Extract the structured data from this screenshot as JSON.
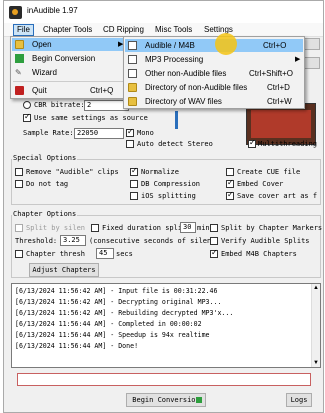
{
  "app": {
    "title": "inAudible 1.97",
    "icon": "app-icon"
  },
  "menubar": [
    {
      "label": "File"
    },
    {
      "label": "Chapter Tools"
    },
    {
      "label": "CD Ripping"
    },
    {
      "label": "Misc Tools"
    },
    {
      "label": "Settings"
    }
  ],
  "file_menu": {
    "items": [
      {
        "label": "Open",
        "icon": "folder-icon",
        "has_submenu": true
      },
      {
        "label": "Begin Conversion",
        "icon": "green-square-icon"
      },
      {
        "label": "Wizard",
        "icon": "wizard-icon"
      },
      {
        "label": "Quit",
        "icon": "quit-icon",
        "shortcut": "Ctrl+Q"
      }
    ]
  },
  "open_submenu": {
    "items": [
      {
        "label": "Audible / M4B",
        "shortcut": "Ctrl+O"
      },
      {
        "label": "MP3 Processing"
      },
      {
        "label": "Other non-Audible files",
        "shortcut": "Ctrl+Shift+O"
      },
      {
        "label": "Directory of non-Audible files",
        "shortcut": "Ctrl+D"
      },
      {
        "label": "Directory of WAV files",
        "shortcut": "Ctrl+W"
      }
    ]
  },
  "encoding": {
    "cbr_label": "CBR bitrate:",
    "cbr_value": "2",
    "use_same_settings": "Use same settings as source",
    "sample_rate_label": "Sample Rate:",
    "sample_rate_value": "22050",
    "mono": "Mono",
    "auto_detect": "Auto detect Stereo",
    "multithreading": "Multithreading"
  },
  "special_options": {
    "title": "Special Options",
    "remove_clips": "Remove \"Audible\" clips",
    "normalize": "Normalize",
    "create_cue": "Create CUE file",
    "do_not_tag": "Do not tag",
    "db_compression": "DB Compression",
    "embed_cover": "Embed Cover",
    "ios_splitting": "iOS splitting",
    "save_cover": "Save cover art as f"
  },
  "chapter_options": {
    "title": "Chapter Options",
    "split_silence": "Split by silen",
    "fixed_duration": "Fixed duration split",
    "fixed_duration_value": "30",
    "fixed_duration_unit": "min",
    "split_markers": "Split by Chapter Markers",
    "threshold_label": "Threshold:",
    "threshold_value": "3.25",
    "threshold_desc": "(consecutive seconds of silen",
    "verify_splits": "Verify Audible Splits",
    "chapter_thresh": "Chapter thresh",
    "chapter_thresh_value": "45",
    "chapter_thresh_unit": "secs",
    "embed_m4b": "Embed M4B Chapters",
    "adjust_button": "Adjust Chapters"
  },
  "log": [
    "[6/13/2024 11:56:42 AM] - Input file is 00:31:22.46",
    "[6/13/2024 11:56:42 AM] - Decrypting original MP3...",
    "[6/13/2024 11:56:42 AM] - Rebuilding decrypted MP3'x...",
    "[6/13/2024 11:56:44 AM] - Completed in 00:00:02",
    "[6/13/2024 11:56:44 AM] - Speedup is 94x realtime",
    "[6/13/2024 11:56:44 AM] - Done!"
  ],
  "bottom": {
    "begin_button": "Begin Conversion",
    "logs_button": "Logs"
  },
  "colors": {
    "highlight": "#91c9f7",
    "menu_active_border": "#2a6ebb",
    "cursor": "#f5c414"
  }
}
